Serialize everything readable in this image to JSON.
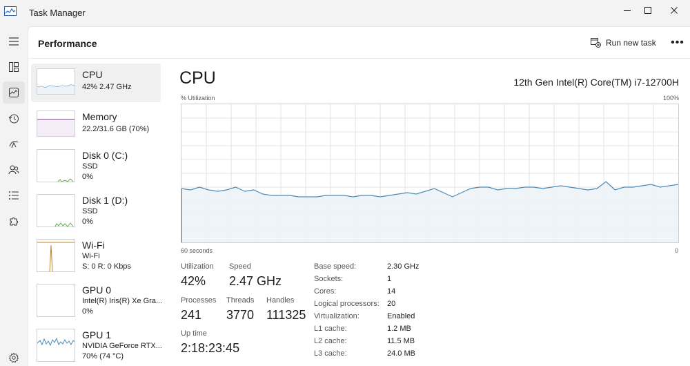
{
  "window": {
    "title": "Task Manager"
  },
  "header": {
    "title": "Performance",
    "run_new_task": "Run new task",
    "more": "•••"
  },
  "devices": [
    {
      "name": "CPU",
      "line1": "42%  2.47 GHz",
      "line2": ""
    },
    {
      "name": "Memory",
      "line1": "22.2/31.6 GB (70%)",
      "line2": ""
    },
    {
      "name": "Disk 0 (C:)",
      "line1": "SSD",
      "line2": "0%"
    },
    {
      "name": "Disk 1 (D:)",
      "line1": "SSD",
      "line2": "0%"
    },
    {
      "name": "Wi-Fi",
      "line1": "Wi-Fi",
      "line2": "S: 0  R: 0 Kbps"
    },
    {
      "name": "GPU 0",
      "line1": "Intel(R) Iris(R) Xe Gra...",
      "line2": "0%"
    },
    {
      "name": "GPU 1",
      "line1": "NVIDIA GeForce RTX...",
      "line2": "70%  (74 °C)"
    }
  ],
  "detail": {
    "title": "CPU",
    "model": "12th Gen Intel(R) Core(TM) i7-12700H",
    "y_axis_label": "% Utilization",
    "y_axis_max": "100%",
    "x_axis_left": "60 seconds",
    "x_axis_right": "0",
    "utilization_label": "Utilization",
    "utilization_value": "42%",
    "speed_label": "Speed",
    "speed_value": "2.47 GHz",
    "processes_label": "Processes",
    "processes_value": "241",
    "threads_label": "Threads",
    "threads_value": "3770",
    "handles_label": "Handles",
    "handles_value": "111325",
    "uptime_label": "Up time",
    "uptime_value": "2:18:23:45",
    "specs": [
      {
        "label": "Base speed:",
        "value": "2.30 GHz"
      },
      {
        "label": "Sockets:",
        "value": "1"
      },
      {
        "label": "Cores:",
        "value": "14"
      },
      {
        "label": "Logical processors:",
        "value": "20"
      },
      {
        "label": "Virtualization:",
        "value": "Enabled"
      },
      {
        "label": "L1 cache:",
        "value": "1.2 MB"
      },
      {
        "label": "L2 cache:",
        "value": "11.5 MB"
      },
      {
        "label": "L3 cache:",
        "value": "24.0 MB"
      }
    ]
  },
  "chart_data": {
    "type": "area",
    "title": "CPU",
    "ylabel": "% Utilization",
    "ylim": [
      0,
      100
    ],
    "x_range_seconds": [
      60,
      0
    ],
    "grid": true,
    "series": [
      {
        "values": [
          39,
          38,
          40,
          38,
          37,
          38,
          40,
          37,
          38,
          35,
          34,
          34,
          34,
          33,
          33,
          33,
          34,
          34,
          34,
          33,
          34,
          34,
          33,
          34,
          35,
          36,
          35,
          37,
          39,
          36,
          33,
          36,
          39,
          40,
          40,
          38,
          39,
          39,
          40,
          40,
          39,
          40,
          41,
          40,
          39,
          38,
          39,
          44,
          38,
          40,
          40,
          41,
          42,
          40,
          41,
          42
        ]
      }
    ],
    "colors": {
      "line": "#4a8ab5",
      "fill": "#edf3f8",
      "grid": "#e3e3e3"
    }
  }
}
